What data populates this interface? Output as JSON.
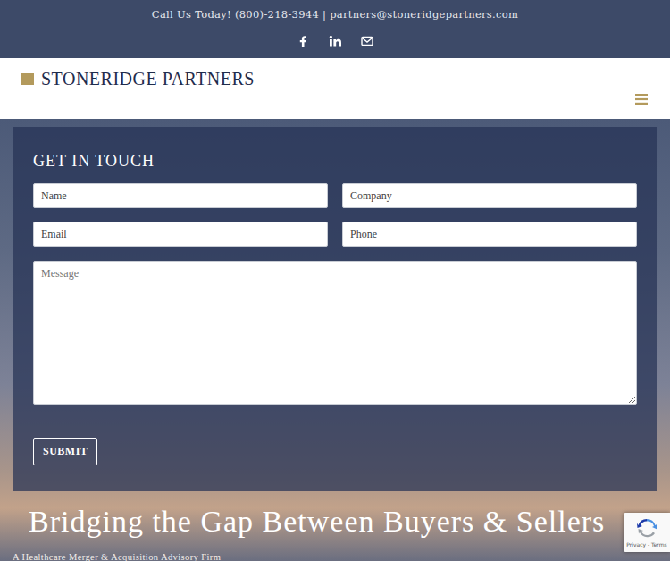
{
  "topbar": {
    "text": "Call Us Today! (800)-218-3944 | partners@stoneridgepartners.com"
  },
  "logo": {
    "text": "STONERIDGE PARTNERS"
  },
  "form": {
    "title": "GET IN TOUCH",
    "fields": [
      "Name",
      "Company",
      "Email",
      "Phone"
    ],
    "message": "Message",
    "submit": "SUBMIT"
  },
  "hero": {
    "headline": "Bridging the Gap Between Buyers & Sellers",
    "subheadline": "A Healthcare Merger & Acquisition Advisory Firm"
  },
  "recaptcha": {
    "links": "Privacy - Terms"
  }
}
